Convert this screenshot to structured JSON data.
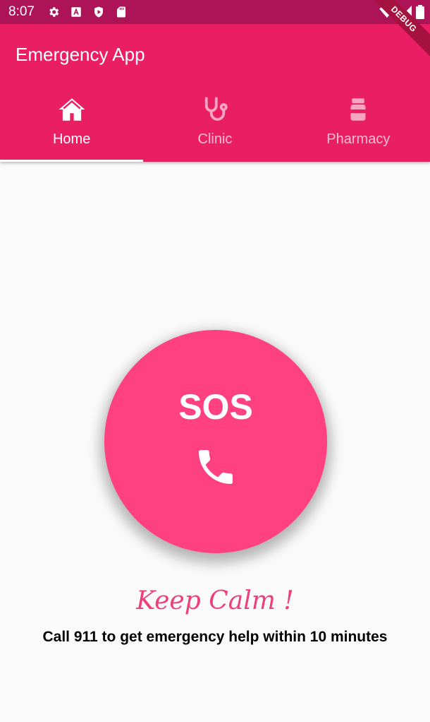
{
  "status_bar": {
    "time": "8:07",
    "icons": [
      "gear-icon",
      "a-letter-icon",
      "play-shield-icon",
      "sd-card-icon",
      "wifi-icon",
      "signal-icon",
      "battery-icon"
    ]
  },
  "debug_banner": "DEBUG",
  "app_bar": {
    "title": "Emergency App",
    "background": "#e91e63"
  },
  "tabs": [
    {
      "label": "Home",
      "icon": "home-icon",
      "selected": true
    },
    {
      "label": "Clinic",
      "icon": "stethoscope-icon",
      "selected": false
    },
    {
      "label": "Pharmacy",
      "icon": "pill-bottle-icon",
      "selected": false
    }
  ],
  "sos": {
    "label": "SOS",
    "icon": "phone-icon",
    "color": "#ff4081"
  },
  "message": {
    "heading": "Keep Calm !",
    "body": "Call 911 to get emergency help within 10 minutes"
  }
}
